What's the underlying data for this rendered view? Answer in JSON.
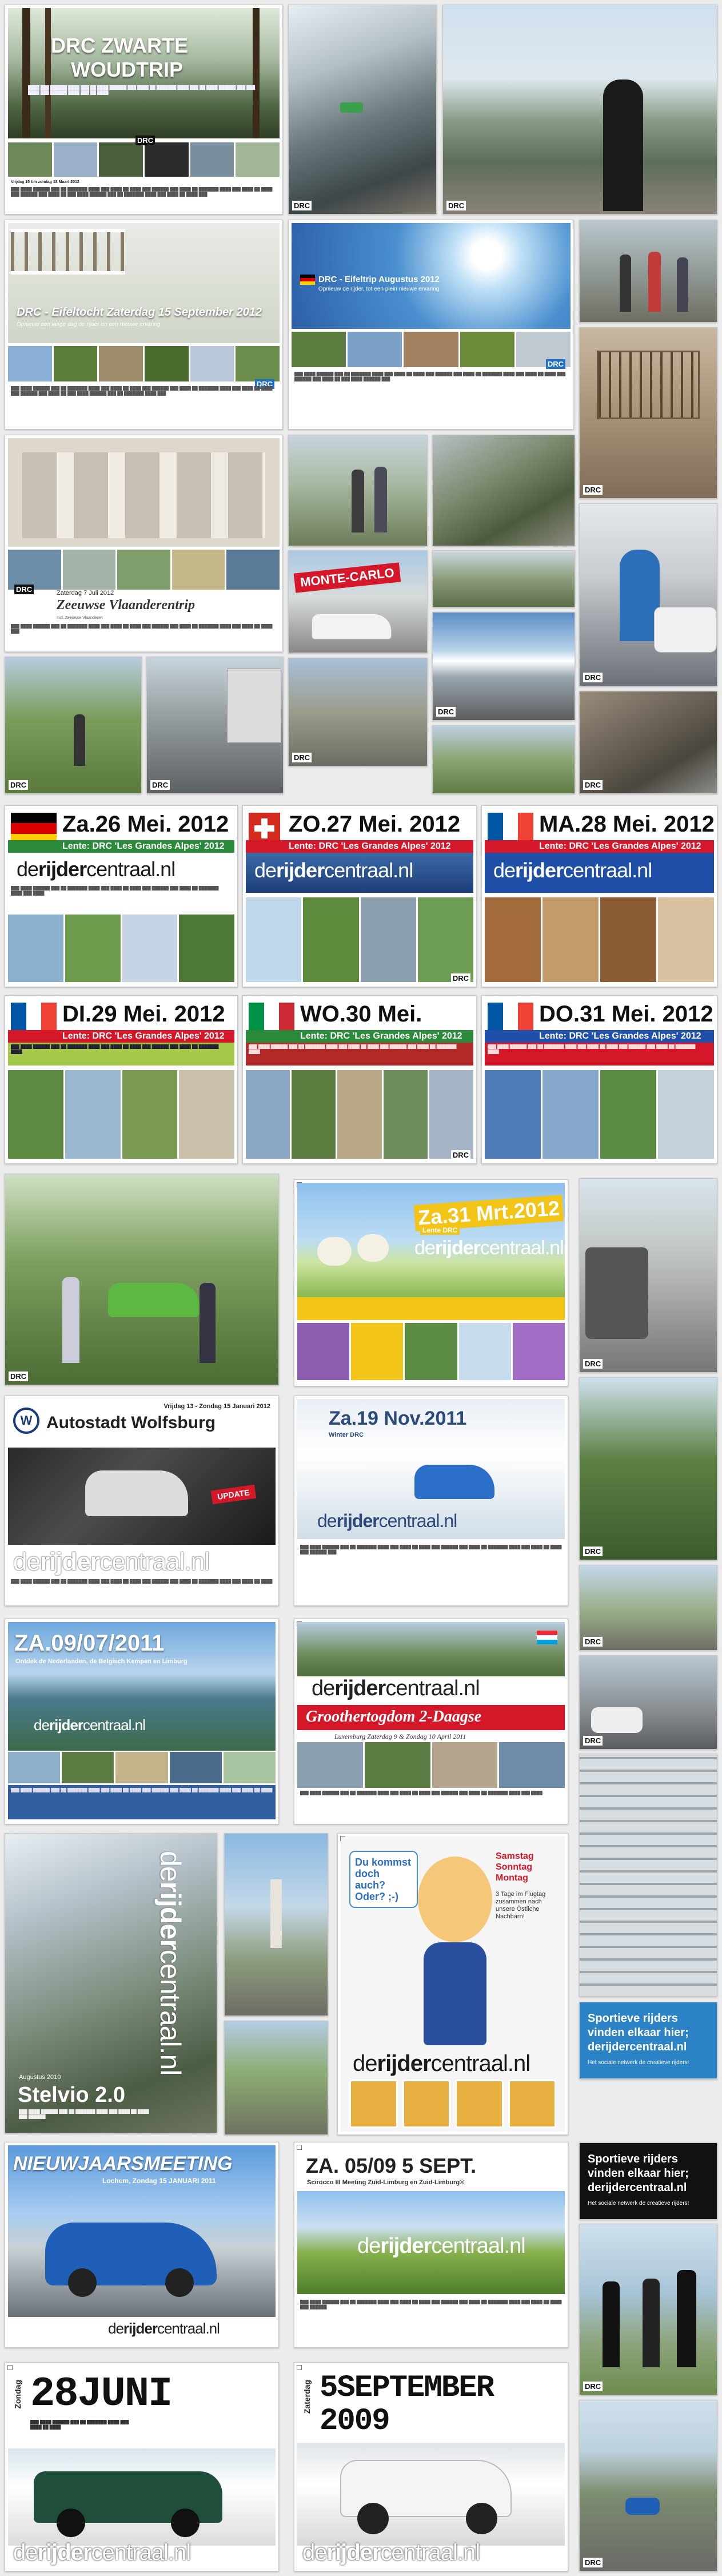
{
  "brand": {
    "short": "DRC",
    "site": "derijdercentraal.nl",
    "site_a": "de",
    "site_b": "rijder",
    "site_c": "centraal.nl"
  },
  "posters": {
    "zwartewoud": {
      "title_line1": "DRC ZWARTE",
      "title_line2": "WOUDTRIP",
      "date": "Vrijdag 15 t/m zondag 18 Maart 2012"
    },
    "eifeltocht": {
      "title": "DRC - Eifeltocht Zaterdag 15 September 2012",
      "sub": "Opnieuw een lange dag de rijder en een nieuwe ervaring"
    },
    "eifeltrip": {
      "title": "DRC - Eifeltrip Augustus 2012",
      "sub": "Opnieuw de rijder, tot een plein nieuwe ervaring"
    },
    "zeeuwse": {
      "date": "Zaterdag 7 Juli 2012",
      "title": "Zeeuwse Vlaanderentrip",
      "sub": "Incl. Zeeuwse Vlaanderen"
    },
    "montecarlo": {
      "sign": "MONTE-CARLO"
    },
    "alpes_days": [
      {
        "title": "Za.26 Mei. 2012",
        "sub": "Lente: DRC 'Les Grandes Alpes' 2012"
      },
      {
        "title": "ZO.27 Mei. 2012",
        "sub": "Lente: DRC 'Les Grandes Alpes' 2012"
      },
      {
        "title": "MA.28 Mei. 2012",
        "sub": "Lente: DRC 'Les Grandes Alpes' 2012"
      },
      {
        "title": "DI.29 Mei. 2012",
        "sub": "Lente: DRC 'Les Grandes Alpes' 2012"
      },
      {
        "title": "WO.30 Mei. 2012",
        "sub": "Lente: DRC 'Les Grandes Alpes' 2012"
      },
      {
        "title": "DO.31 Mei. 2012",
        "sub": "Lente: DRC 'Les Grandes Alpes' 2012"
      }
    ],
    "maart": {
      "title": "Za.31 Mrt.2012",
      "sub": "Lente DRC"
    },
    "wolfsburg": {
      "date": "Vrijdag 13 - Zondag 15 Januari 2012",
      "title": "Autostadt Wolfsburg",
      "update": "UPDATE"
    },
    "nov": {
      "title": "Za.19 Nov.2011",
      "sub": "Winter DRC"
    },
    "juli2011": {
      "title": "ZA.09/07/2011",
      "sub": "Ontdek de Nederlanden, de Belgisch Kempen en Limburg"
    },
    "luxemburg": {
      "title": "Groothertogdom 2-Daagse",
      "sub": "Luxemburg Zaterdag 9 & Zondag 10 April 2011"
    },
    "stelvio": {
      "date": "Augustus 2010",
      "title": "Stelvio 2.0"
    },
    "oktoberfest": {
      "q1": "Du kommst",
      "q2": "doch auch?",
      "q3": "Oder? ;-)",
      "days": "Samstag\nSonntag\nMontag",
      "info": "3 Tage im Flugtag zusammen nach unsere Östliche Nachbarn!"
    },
    "ad": {
      "line1": "Sportieve rijders",
      "line2": "vinden elkaar hier;",
      "line3": "derijdercentraal.nl",
      "small": "Het sociale netwerk de creatieve rijders!"
    },
    "nieuwjaar": {
      "title": "NIEUWJAARSMEETING",
      "sub": "Lochem, Zondag 15 JANUARI 2011"
    },
    "sept": {
      "title": "ZA. 05/09 5 SEPT.",
      "sub": "Scirocco III Meeting Zuid-Limburg en Zuid-Limburg®"
    },
    "juni": {
      "day": "Zondag",
      "title": "28JUNI"
    },
    "september2009": {
      "day": "Zaterdag",
      "title": "5SEPTEMBER",
      "year": "2009"
    }
  },
  "colors": {
    "drc_blue": "#1f6fc5",
    "alpes_red": "#d4182a",
    "ad_blue": "#2b82c4",
    "yellow": "#f2c418"
  }
}
